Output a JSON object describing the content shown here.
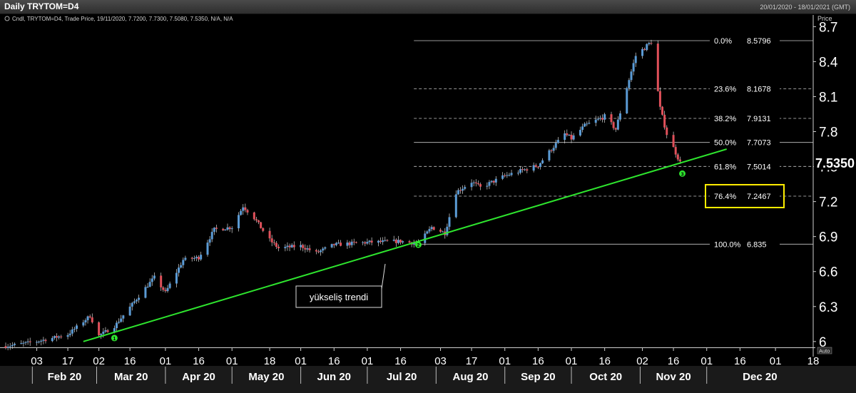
{
  "window": {
    "title": "Daily TRYTOM=D4",
    "date_range": "20/01/2020 - 18/01/2021 (GMT)"
  },
  "legend": "Cndl, TRYTOM=D4, Trade Price, 19/11/2020, 7.7200, 7.7300, 7.5080, 7.5350, N/A, N/A",
  "axis": {
    "price_header": "Price",
    "auto_label": "Auto",
    "last_price": "7.5350"
  },
  "annotation": {
    "trend_label": "yükseliş trendi",
    "points": [
      "1",
      "2",
      "3"
    ]
  },
  "colors": {
    "background": "#000000",
    "up_candle": "#5b9bd5",
    "down_candle": "#e0505a",
    "trend_line": "#2ee52e",
    "fib_line": "#c8c8c8",
    "highlight_box": "#ffee00"
  },
  "chart_data": {
    "type": "candlestick",
    "symbol": "TRYTOM=D4",
    "ylim": [
      5.95,
      8.8
    ],
    "yticks": [
      6,
      6.3,
      6.6,
      6.9,
      7.2,
      7.5,
      7.8,
      8.1,
      8.4,
      8.7
    ],
    "ytick_labels": [
      "6",
      "6.3",
      "6.6",
      "6.9",
      "7.2",
      "7.5",
      "7.8",
      "8.1",
      "8.4",
      "8.7"
    ],
    "x_start": "2020-01-20",
    "x_end": "2021-01-18",
    "x_day_ticks": [
      {
        "date": "2020-02-03",
        "label": "03"
      },
      {
        "date": "2020-02-17",
        "label": "17"
      },
      {
        "date": "2020-03-02",
        "label": "02"
      },
      {
        "date": "2020-03-16",
        "label": "16"
      },
      {
        "date": "2020-04-01",
        "label": "01"
      },
      {
        "date": "2020-04-16",
        "label": "16"
      },
      {
        "date": "2020-05-01",
        "label": "01"
      },
      {
        "date": "2020-05-18",
        "label": "18"
      },
      {
        "date": "2020-06-01",
        "label": "01"
      },
      {
        "date": "2020-06-16",
        "label": "16"
      },
      {
        "date": "2020-07-01",
        "label": "01"
      },
      {
        "date": "2020-07-16",
        "label": "16"
      },
      {
        "date": "2020-08-03",
        "label": "03"
      },
      {
        "date": "2020-08-17",
        "label": "17"
      },
      {
        "date": "2020-09-01",
        "label": "01"
      },
      {
        "date": "2020-09-16",
        "label": "16"
      },
      {
        "date": "2020-10-01",
        "label": "01"
      },
      {
        "date": "2020-10-16",
        "label": "16"
      },
      {
        "date": "2020-11-02",
        "label": "02"
      },
      {
        "date": "2020-11-16",
        "label": "16"
      },
      {
        "date": "2020-12-01",
        "label": "01"
      },
      {
        "date": "2020-12-16",
        "label": "16"
      },
      {
        "date": "2021-01-01",
        "label": "01"
      },
      {
        "date": "2021-01-18",
        "label": "18"
      }
    ],
    "x_months": [
      {
        "date": "2020-02-01",
        "label": "Feb 20"
      },
      {
        "date": "2020-03-01",
        "label": "Mar 20"
      },
      {
        "date": "2020-04-01",
        "label": "Apr 20"
      },
      {
        "date": "2020-05-01",
        "label": "May 20"
      },
      {
        "date": "2020-06-01",
        "label": "Jun 20"
      },
      {
        "date": "2020-07-01",
        "label": "Jul 20"
      },
      {
        "date": "2020-08-01",
        "label": "Aug 20"
      },
      {
        "date": "2020-09-01",
        "label": "Sep 20"
      },
      {
        "date": "2020-10-01",
        "label": "Oct 20"
      },
      {
        "date": "2020-11-01",
        "label": "Nov 20"
      },
      {
        "date": "2020-12-01",
        "label": "Dec 20"
      }
    ],
    "closes": [
      {
        "date": "2020-01-20",
        "close": 5.96
      },
      {
        "date": "2020-02-03",
        "close": 6.0
      },
      {
        "date": "2020-02-17",
        "close": 6.06
      },
      {
        "date": "2020-02-27",
        "close": 6.22
      },
      {
        "date": "2020-03-02",
        "close": 6.05
      },
      {
        "date": "2020-03-09",
        "close": 6.13
      },
      {
        "date": "2020-03-23",
        "close": 6.46
      },
      {
        "date": "2020-03-27",
        "close": 6.55
      },
      {
        "date": "2020-04-01",
        "close": 6.42
      },
      {
        "date": "2020-04-09",
        "close": 6.7
      },
      {
        "date": "2020-04-16",
        "close": 6.72
      },
      {
        "date": "2020-04-23",
        "close": 6.96
      },
      {
        "date": "2020-05-01",
        "close": 6.98
      },
      {
        "date": "2020-05-06",
        "close": 7.16
      },
      {
        "date": "2020-05-11",
        "close": 7.06
      },
      {
        "date": "2020-05-18",
        "close": 6.87
      },
      {
        "date": "2020-05-22",
        "close": 6.8
      },
      {
        "date": "2020-06-01",
        "close": 6.82
      },
      {
        "date": "2020-06-08",
        "close": 6.76
      },
      {
        "date": "2020-06-16",
        "close": 6.83
      },
      {
        "date": "2020-07-01",
        "close": 6.85
      },
      {
        "date": "2020-07-16",
        "close": 6.86
      },
      {
        "date": "2020-07-24",
        "close": 6.84
      },
      {
        "date": "2020-07-30",
        "close": 6.98
      },
      {
        "date": "2020-08-05",
        "close": 6.93
      },
      {
        "date": "2020-08-10",
        "close": 7.28
      },
      {
        "date": "2020-08-17",
        "close": 7.37
      },
      {
        "date": "2020-08-21",
        "close": 7.32
      },
      {
        "date": "2020-09-01",
        "close": 7.42
      },
      {
        "date": "2020-09-16",
        "close": 7.51
      },
      {
        "date": "2020-09-22",
        "close": 7.65
      },
      {
        "date": "2020-09-28",
        "close": 7.78
      },
      {
        "date": "2020-10-01",
        "close": 7.74
      },
      {
        "date": "2020-10-07",
        "close": 7.85
      },
      {
        "date": "2020-10-16",
        "close": 7.93
      },
      {
        "date": "2020-10-21",
        "close": 7.82
      },
      {
        "date": "2020-10-26",
        "close": 8.18
      },
      {
        "date": "2020-10-30",
        "close": 8.45
      },
      {
        "date": "2020-11-06",
        "close": 8.57
      },
      {
        "date": "2020-11-10",
        "close": 8.0
      },
      {
        "date": "2020-11-13",
        "close": 7.78
      },
      {
        "date": "2020-11-16",
        "close": 7.66
      },
      {
        "date": "2020-11-19",
        "close": 7.535
      }
    ],
    "fibonacci": [
      {
        "level": "0.0%",
        "value": "8.5796"
      },
      {
        "level": "23.6%",
        "value": "8.1678"
      },
      {
        "level": "38.2%",
        "value": "7.9131"
      },
      {
        "level": "50.0%",
        "value": "7.7073"
      },
      {
        "level": "61.8%",
        "value": "7.5014"
      },
      {
        "level": "76.4%",
        "value": "7.2467"
      },
      {
        "level": "100.0%",
        "value": "6.835"
      }
    ],
    "fib_start": "2020-07-22",
    "highlight_level": "76.4%",
    "trendline": [
      {
        "date": "2020-02-24",
        "price": 6.0
      },
      {
        "date": "2020-12-10",
        "price": 7.65
      }
    ],
    "pivots": [
      {
        "label": "1",
        "date": "2020-03-09",
        "price": 6.03
      },
      {
        "label": "2",
        "date": "2020-07-24",
        "price": 6.83
      },
      {
        "label": "3",
        "date": "2020-11-20",
        "price": 7.44
      }
    ]
  }
}
